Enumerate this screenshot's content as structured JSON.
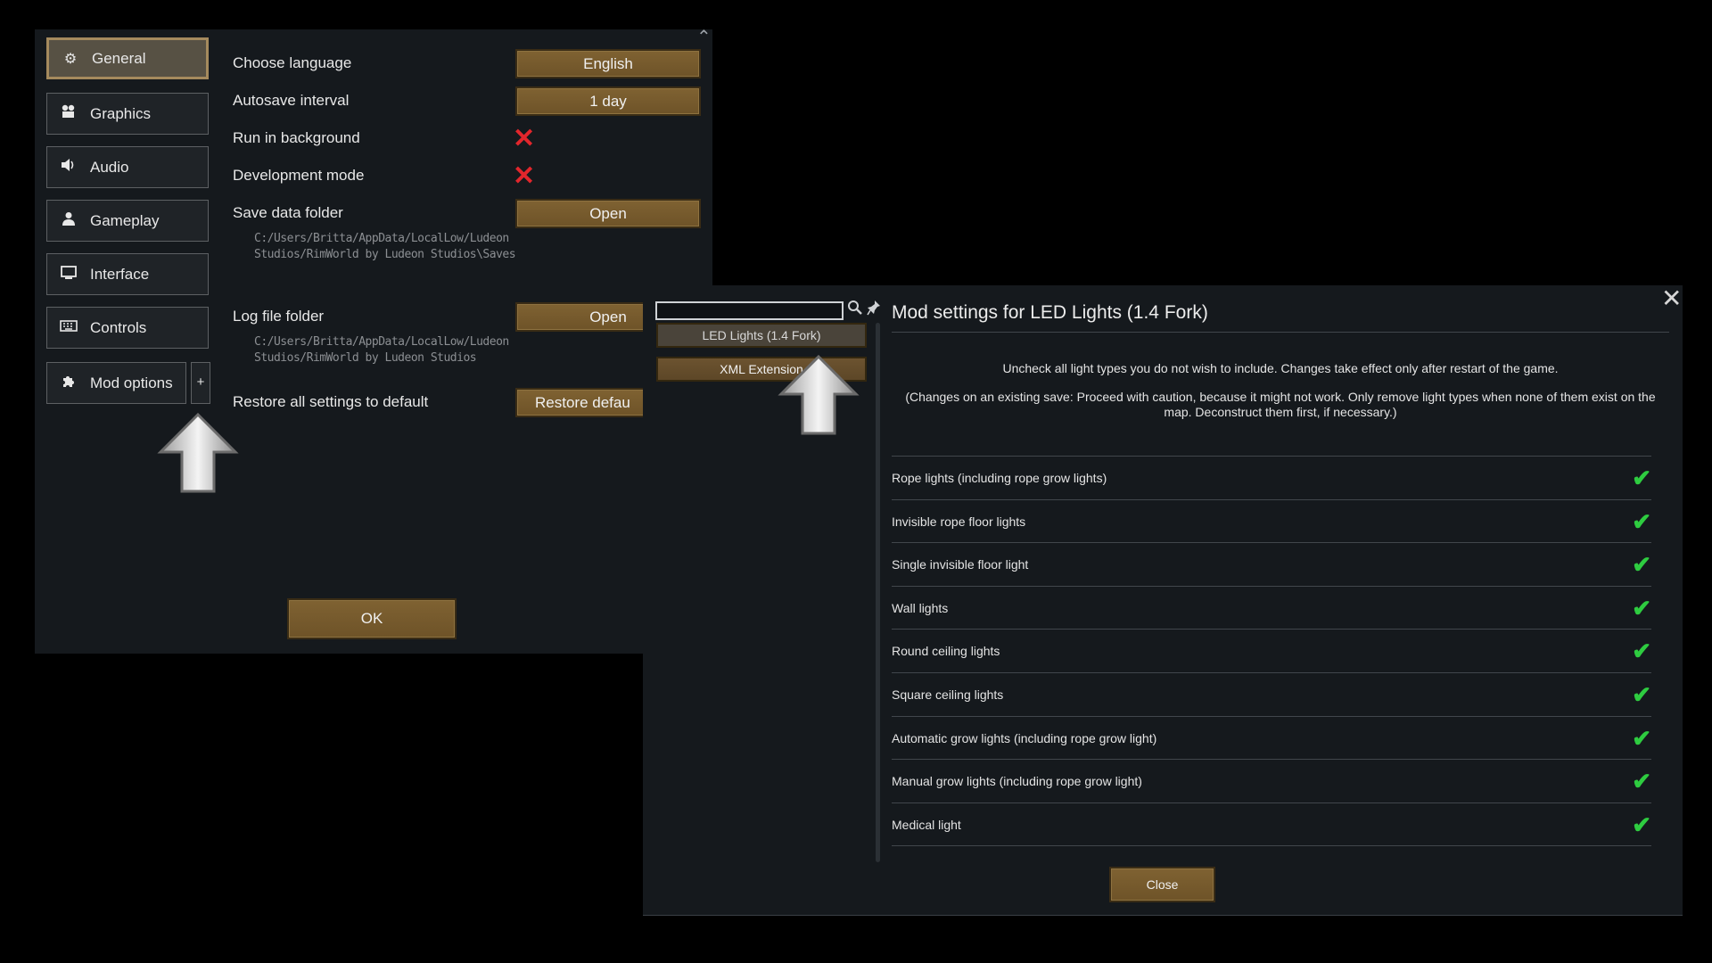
{
  "general_window": {
    "tabs": [
      {
        "label": "General",
        "icon": "gear-icon",
        "active": true
      },
      {
        "label": "Graphics",
        "icon": "graphics-icon",
        "active": false
      },
      {
        "label": "Audio",
        "icon": "speaker-icon",
        "active": false
      },
      {
        "label": "Gameplay",
        "icon": "person-icon",
        "active": false
      },
      {
        "label": "Interface",
        "icon": "monitor-icon",
        "active": false
      },
      {
        "label": "Controls",
        "icon": "keyboard-icon",
        "active": false
      },
      {
        "label": "Mod options",
        "icon": "puzzle-icon",
        "active": false
      }
    ],
    "add_button_label": "+",
    "rows": {
      "language": {
        "label": "Choose language",
        "value": "English"
      },
      "autosave": {
        "label": "Autosave interval",
        "value": "1 day"
      },
      "run_background": {
        "label": "Run in background",
        "checked": false
      },
      "dev_mode": {
        "label": "Development mode",
        "checked": false
      },
      "save_folder": {
        "label": "Save data folder",
        "button": "Open",
        "path_line1": "C:/Users/Britta/AppData/LocalLow/Ludeon",
        "path_line2": "Studios/RimWorld by Ludeon Studios\\Saves"
      },
      "log_folder": {
        "label": "Log file folder",
        "button": "Open",
        "path_line1": "C:/Users/Britta/AppData/LocalLow/Ludeon",
        "path_line2": "Studios/RimWorld by Ludeon Studios"
      },
      "restore": {
        "label": "Restore all settings to default",
        "button": "Restore defau"
      }
    },
    "ok_label": "OK",
    "x_mark": "✕"
  },
  "mod_window": {
    "search_placeholder": "",
    "mod_list": [
      "LED Lights (1.4 Fork)",
      "XML Extension"
    ],
    "title": "Mod settings for LED Lights (1.4 Fork)",
    "description1": "Uncheck all light types you do not wish to include. Changes take effect only after restart of the game.",
    "description2": "(Changes on an existing save: Proceed with caution, because it might not work. Only remove light types when none of them exist on the map. Deconstruct them first, if necessary.)",
    "options": [
      {
        "label": "Rope lights (including rope grow lights)",
        "checked": true
      },
      {
        "label": "Invisible rope floor lights",
        "checked": true
      },
      {
        "label": "Single invisible floor light",
        "checked": true
      },
      {
        "label": "Wall lights",
        "checked": true
      },
      {
        "label": "Round ceiling lights",
        "checked": true
      },
      {
        "label": "Square ceiling lights",
        "checked": true
      },
      {
        "label": "Automatic grow lights (including rope grow light)",
        "checked": true
      },
      {
        "label": "Manual grow lights (including rope grow light)",
        "checked": true
      },
      {
        "label": "Medical light",
        "checked": true
      }
    ],
    "check_mark": "✔",
    "close_label": "Close",
    "close_x": "✕"
  }
}
